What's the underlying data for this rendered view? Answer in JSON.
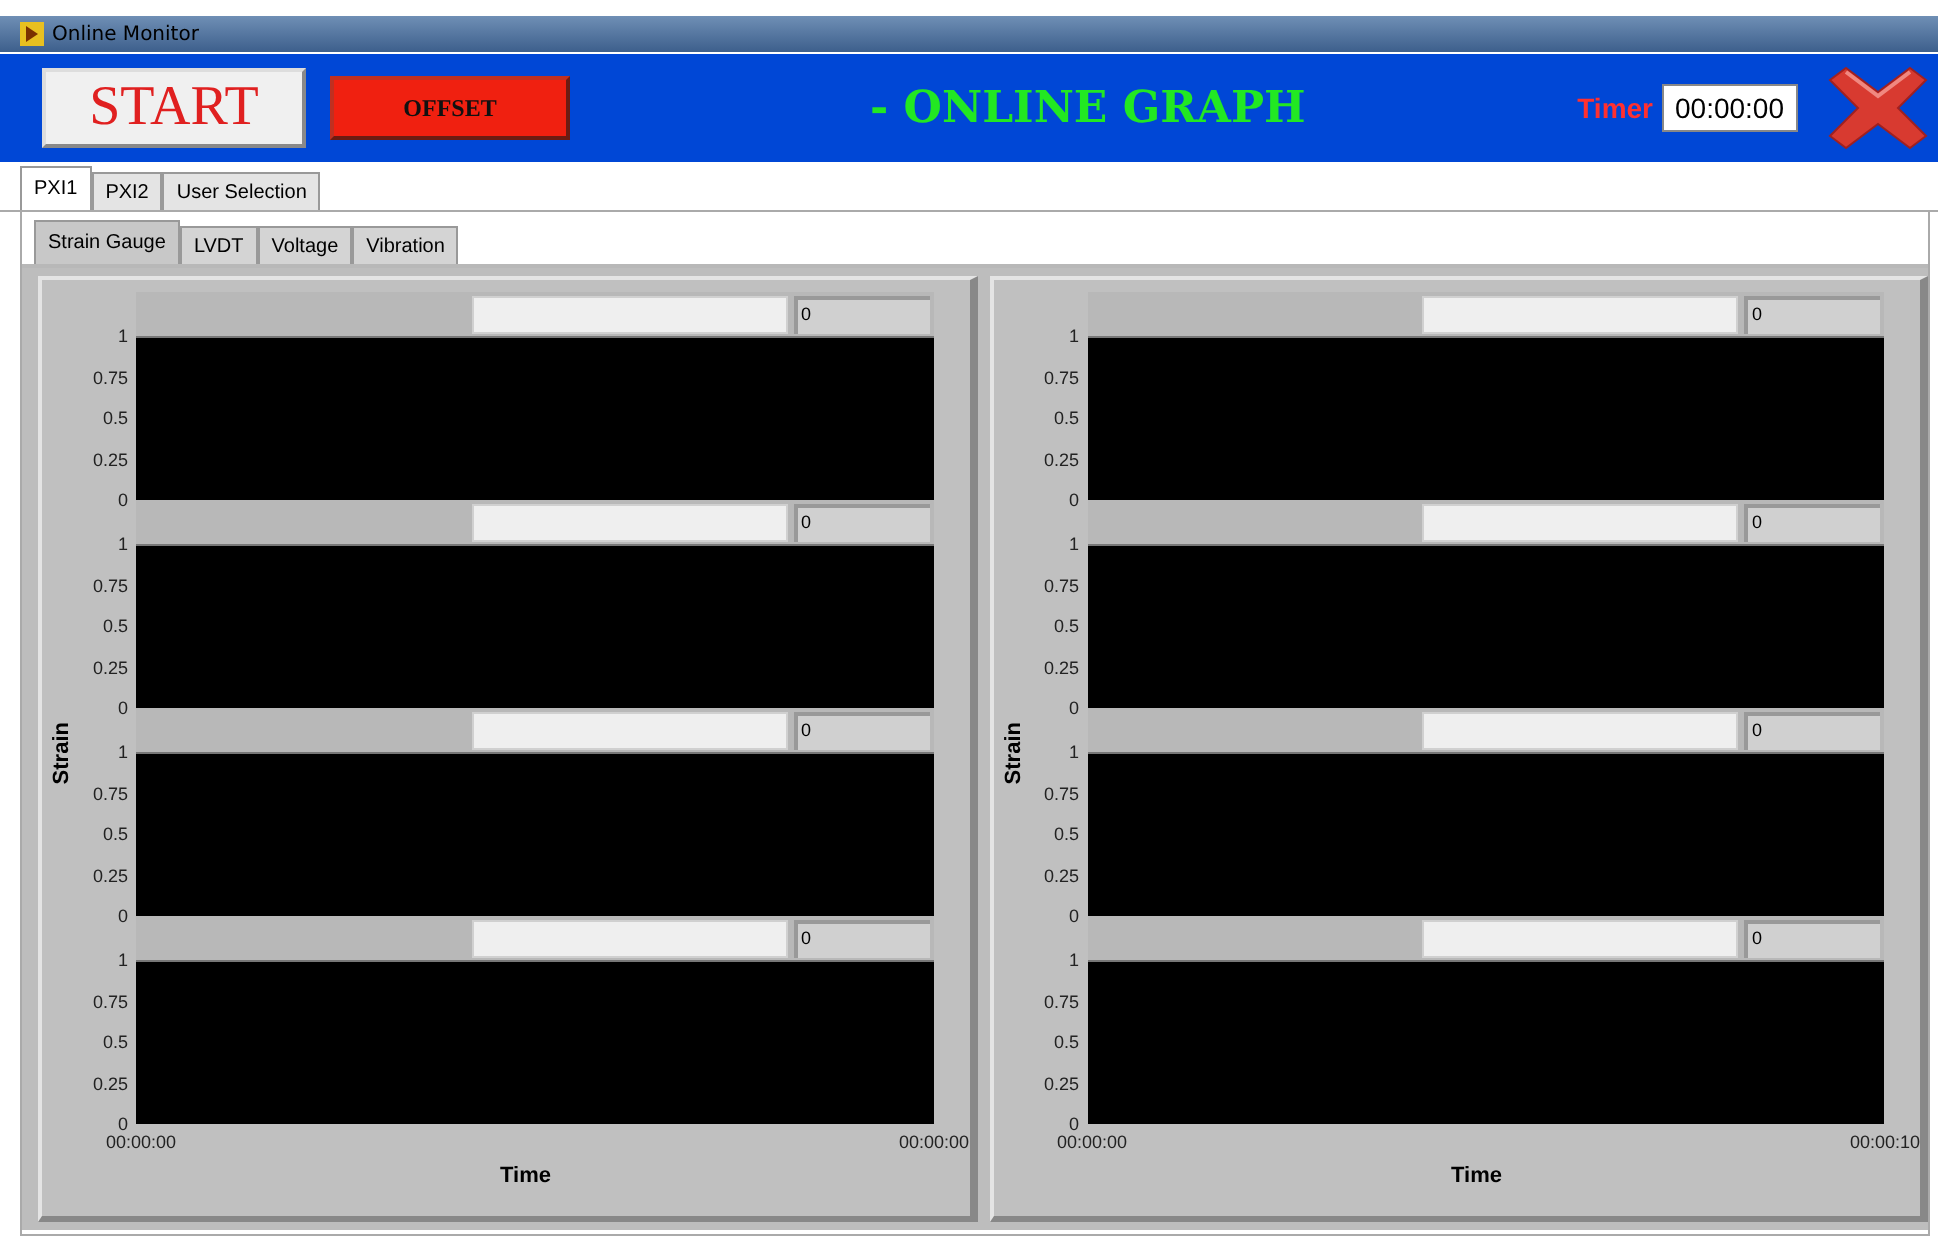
{
  "window": {
    "title": "Online Monitor"
  },
  "header": {
    "start_button": "START",
    "offset_button": "OFFSET",
    "title": "- ONLINE GRAPH",
    "timer_label": "Timer",
    "timer_value": "00:00:00"
  },
  "tabs": [
    {
      "label": "PXI1",
      "selected": true
    },
    {
      "label": "PXI2",
      "selected": false
    },
    {
      "label": "User Selection",
      "selected": false
    }
  ],
  "subtabs": [
    {
      "label": "Strain Gauge",
      "selected": true
    },
    {
      "label": "LVDT",
      "selected": false
    },
    {
      "label": "Voltage",
      "selected": false
    },
    {
      "label": "Vibration",
      "selected": false
    }
  ],
  "panels": [
    {
      "ylabel": "Strain",
      "xlabel": "Time",
      "x_start": "00:00:00",
      "x_end": "00:00:00",
      "plots": [
        {
          "value": "0",
          "yticks": [
            "1",
            "0.75",
            "0.5",
            "0.25",
            "0"
          ]
        },
        {
          "value": "0",
          "yticks": [
            "1",
            "0.75",
            "0.5",
            "0.25",
            "0"
          ]
        },
        {
          "value": "0",
          "yticks": [
            "1",
            "0.75",
            "0.5",
            "0.25",
            "0"
          ]
        },
        {
          "value": "0",
          "yticks": [
            "1",
            "0.75",
            "0.5",
            "0.25",
            "0"
          ]
        }
      ]
    },
    {
      "ylabel": "Strain",
      "xlabel": "Time",
      "x_start": "00:00:00",
      "x_end": "00:00:10",
      "plots": [
        {
          "value": "0",
          "yticks": [
            "1",
            "0.75",
            "0.5",
            "0.25",
            "0"
          ]
        },
        {
          "value": "0",
          "yticks": [
            "1",
            "0.75",
            "0.5",
            "0.25",
            "0"
          ]
        },
        {
          "value": "0",
          "yticks": [
            "1",
            "0.75",
            "0.5",
            "0.25",
            "0"
          ]
        },
        {
          "value": "0",
          "yticks": [
            "1",
            "0.75",
            "0.5",
            "0.25",
            "0"
          ]
        }
      ]
    }
  ]
}
